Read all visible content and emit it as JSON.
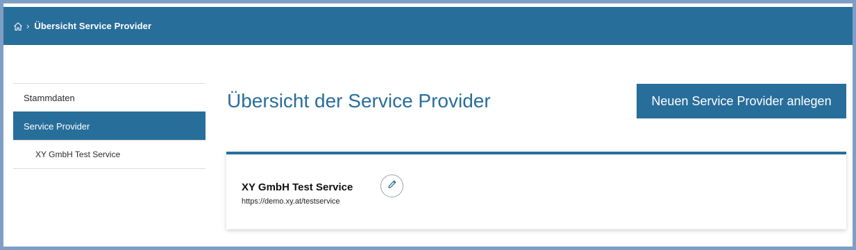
{
  "breadcrumb": {
    "home_icon": "home-icon",
    "separator": "›",
    "current": "Übersicht Service Provider"
  },
  "sidebar": {
    "items": [
      {
        "label": "Stammdaten",
        "active": false
      },
      {
        "label": "Service Provider",
        "active": true
      },
      {
        "label": "XY GmbH Test Service",
        "active": false,
        "sub": true
      }
    ]
  },
  "main": {
    "title": "Übersicht der Service Provider",
    "new_button_label": "Neuen Service Provider anlegen"
  },
  "providers": [
    {
      "name": "XY GmbH Test Service",
      "url": "https://demo.xy.at/testservice",
      "edit_icon": "pencil-icon"
    }
  ],
  "colors": {
    "primary": "#286e9b",
    "outer_border": "#7f9ec4",
    "text": "#111111"
  }
}
